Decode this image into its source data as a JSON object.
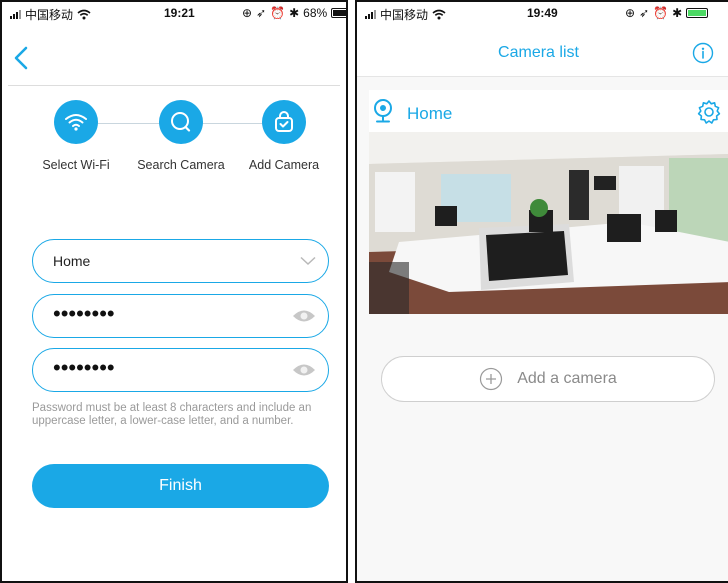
{
  "left": {
    "status": {
      "carrier": "中国移动",
      "time": "19:21",
      "battery": "68%"
    },
    "steps": [
      {
        "label": "Select Wi-Fi",
        "icon": "wifi-icon"
      },
      {
        "label": "Search Camera",
        "icon": "search-camera-icon"
      },
      {
        "label": "Add Camera",
        "icon": "add-camera-icon"
      }
    ],
    "form": {
      "network": "Home",
      "password": "••••••••",
      "confirm_password": "••••••••",
      "hint": "Password must be at least 8 characters and include an uppercase letter, a lower-case letter, and a number.",
      "finish_label": "Finish"
    }
  },
  "right": {
    "status": {
      "carrier": "中国移动",
      "time": "19:49"
    },
    "title": "Camera list",
    "camera": {
      "name": "Home",
      "icon": "camera-icon"
    },
    "add_label": "Add a camera"
  },
  "colors": {
    "accent": "#1aa8e6",
    "hint": "#9a9a9a",
    "outline": "#cfcfcf"
  }
}
